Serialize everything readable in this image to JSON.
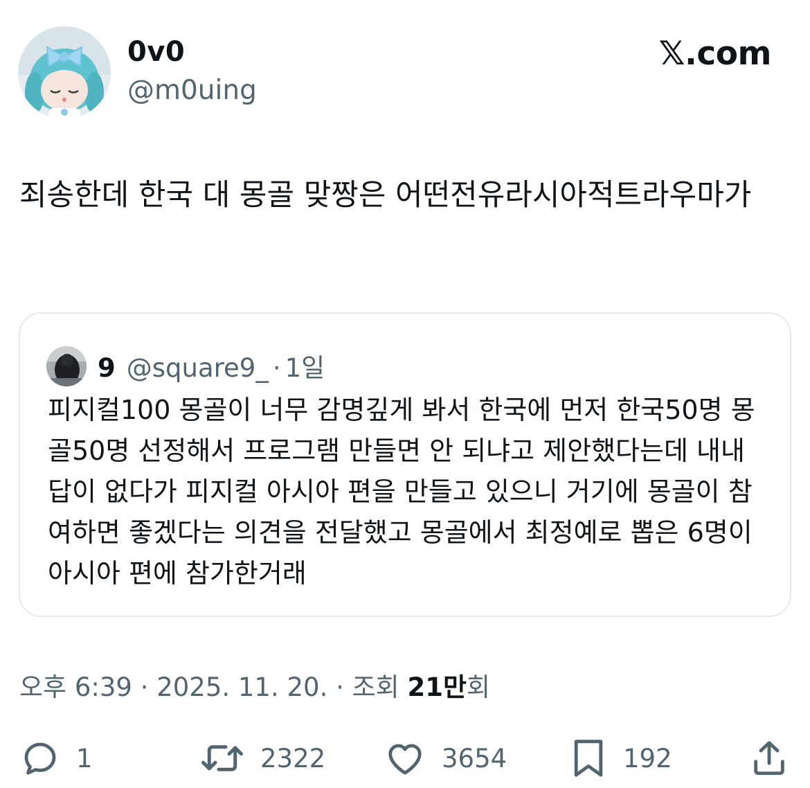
{
  "author": {
    "display_name": "0v0",
    "handle": "@m0uing",
    "avatar_icon": "avatar-anime-figure"
  },
  "brand": {
    "label": "𝕏.com"
  },
  "tweet": {
    "text": "죄송한데 한국 대 몽골 맞짱은 어떤전유라시아적트라우마가"
  },
  "quoted": {
    "display_name": "9",
    "handle": "@square9_",
    "separator": "·",
    "time": "1일",
    "text": "피지컬100 몽골이 너무 감명깊게 봐서 한국에 먼저 한국50명 몽골50명 선정해서 프로그램 만들면 안 되냐고 제안했다는데 내내 답이 없다가 피지컬 아시아 편을 만들고 있으니 거기에 몽골이 참여하면 좋겠다는 의견을 전달했고 몽골에서 최정예로 뽑은 6명이 아시아 편에 참가한거래"
  },
  "meta": {
    "timestamp": "오후 6:39 · 2025. 11. 20. · 조회",
    "views_number": "21만",
    "views_suffix": "회"
  },
  "actions": {
    "reply_count": "1",
    "retweet_count": "2322",
    "like_count": "3654",
    "bookmark_count": "192"
  },
  "colors": {
    "text_primary": "#0f1419",
    "text_secondary": "#536471",
    "border": "#e6e9ec"
  }
}
